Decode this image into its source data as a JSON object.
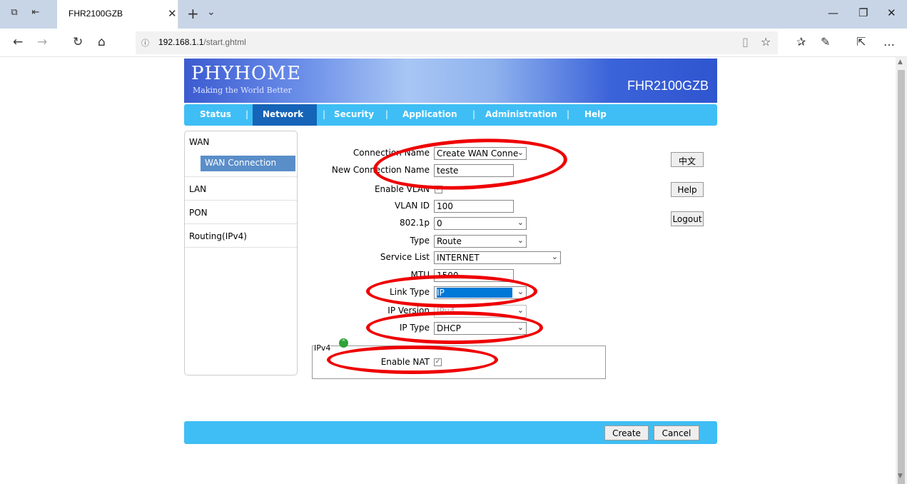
{
  "browser": {
    "tab_title": "FHR2100GZB",
    "url_host": "192.168.1.1",
    "url_path": "/start.ghtml"
  },
  "banner": {
    "logo": "PHYHOME",
    "slogan": "Making the World Better",
    "model": "FHR2100GZB"
  },
  "menu": [
    "Status",
    "Network",
    "Security",
    "Application",
    "Administration",
    "Help"
  ],
  "active_menu": "Network",
  "sidebar": {
    "wan": "WAN",
    "wan_connection": "WAN Connection",
    "lan": "LAN",
    "pon": "PON",
    "routing": "Routing(IPv4)"
  },
  "form": {
    "connection_name_label": "Connection Name",
    "connection_name_value": "Create WAN Conne",
    "new_connection_name_label": "New Connection Name",
    "new_connection_name_value": "teste",
    "enable_vlan_label": "Enable VLAN",
    "enable_vlan_checked": true,
    "vlan_id_label": "VLAN ID",
    "vlan_id_value": "100",
    "p8021_label": "802.1p",
    "p8021_value": "0",
    "type_label": "Type",
    "type_value": "Route",
    "service_list_label": "Service List",
    "service_list_value": "INTERNET",
    "mtu_label": "MTU",
    "mtu_value": "1500",
    "link_type_label": "Link Type",
    "link_type_value": "IP",
    "ip_version_label": "IP Version",
    "ip_version_value": "IPv4",
    "ip_type_label": "IP Type",
    "ip_type_value": "DHCP",
    "ipv4_legend": "IPv4",
    "enable_nat_label": "Enable NAT",
    "enable_nat_checked": true
  },
  "side_buttons": {
    "chinese": "中文",
    "help": "Help",
    "logout": "Logout"
  },
  "footer": {
    "create": "Create",
    "cancel": "Cancel"
  },
  "colors": {
    "menu_bg": "#3fbef5",
    "menu_active": "#1564b8",
    "highlight_ring": "#ee0000"
  }
}
